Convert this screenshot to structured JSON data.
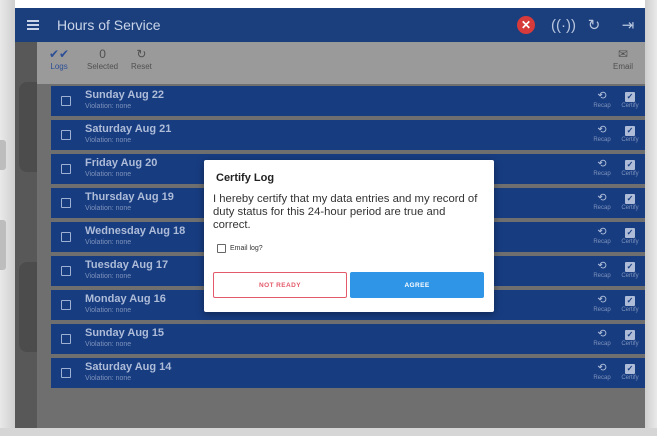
{
  "appbar": {
    "title": "Hours of Service",
    "icons": [
      "menu-icon",
      "error-icon",
      "signal-icon",
      "refresh-icon",
      "logout-icon"
    ]
  },
  "toolbar": {
    "logs_label": "Logs",
    "selected_count": "0",
    "selected_label": "Selected",
    "reset_label": "Reset",
    "email_label": "Email"
  },
  "logs": [
    {
      "date": "Sunday Aug 22",
      "violation": "Violation: none"
    },
    {
      "date": "Saturday Aug 21",
      "violation": "Violation: none"
    },
    {
      "date": "Friday Aug 20",
      "violation": "Violation: none"
    },
    {
      "date": "Thursday Aug 19",
      "violation": "Violation: none"
    },
    {
      "date": "Wednesday Aug 18",
      "violation": "Violation: none"
    },
    {
      "date": "Tuesday Aug 17",
      "violation": "Violation: none"
    },
    {
      "date": "Monday Aug 16",
      "violation": "Violation: none"
    },
    {
      "date": "Sunday Aug 15",
      "violation": "Violation: none"
    },
    {
      "date": "Saturday Aug 14",
      "violation": "Violation: none"
    }
  ],
  "row_actions": {
    "recap_label": "Recap",
    "certify_label": "Certify"
  },
  "dialog": {
    "title": "Certify Log",
    "body": "I hereby certify that my data entries and my record of duty status for this 24-hour period are true and correct.",
    "email_checkbox_label": "Email log?",
    "email_checked": false,
    "not_ready_label": "NOT READY",
    "agree_label": "AGREE"
  },
  "colors": {
    "appbar": "#1b3f7d",
    "row": "#173c80",
    "agree": "#2f95e6",
    "not_ready": "#e35a6a",
    "error_badge": "#d63a3a"
  }
}
